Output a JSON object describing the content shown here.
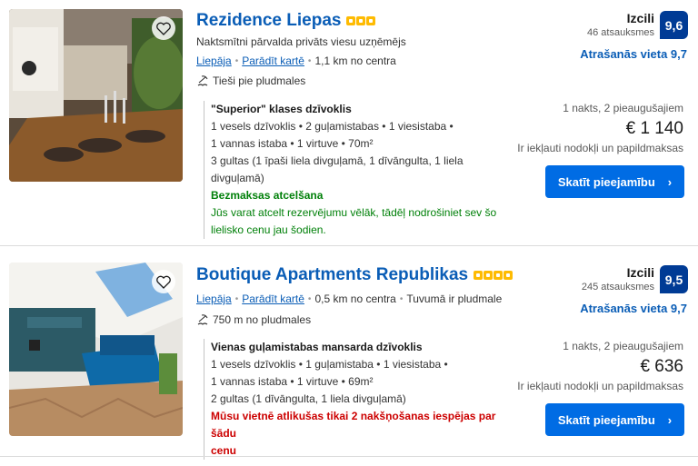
{
  "listings": [
    {
      "name": "Rezidence Liepas",
      "host": "Naktsmītni pārvalda privāts viesu uzņēmējs",
      "city": "Liepāja",
      "map_link": "Parādīt kartē",
      "distance": "1,1 km no centra",
      "extra_location": "",
      "beach": "Tieši pie pludmales",
      "room_type": "\"Superior\" klases dzīvoklis",
      "room_line1": "1 vesels dzīvoklis • 2 guļamistabas • 1 viesistaba •",
      "room_line2": "1 vannas istaba • 1 virtuve • 70m²",
      "beds": "3 gultas (1 īpaši liela divguļamā, 1 dīvāngulta, 1 liela divguļamā)",
      "cancel_title": "Bezmaksas atcelšana",
      "cancel_text1": "Jūs varat atcelt rezervējumu vēlāk, tādēļ nodrošiniet sev šo",
      "cancel_text2": "lielisko cenu jau šodien.",
      "rating_word": "Izcili",
      "reviews": "46 atsauksmes",
      "score": "9,6",
      "location_score": "Atrašanās vieta 9,7",
      "nights": "1 nakts, 2 pieaugušajiem",
      "price": "€ 1 140",
      "taxes": "Ir iekļauti nodokļi un papildmaksas",
      "button": "Skatīt pieejamību",
      "stars": 3
    },
    {
      "name": "Boutique Apartments Republikas",
      "city": "Liepāja",
      "map_link": "Parādīt kartē",
      "distance": "0,5 km no centra",
      "extra_location": "Tuvumā ir pludmale",
      "beach": "750 m no pludmales",
      "room_type": "Vienas guļamistabas mansarda dzīvoklis",
      "room_line1": "1 vesels dzīvoklis • 1 guļamistaba • 1 viesistaba •",
      "room_line2": "1 vannas istaba • 1 virtuve • 69m²",
      "beds": "2 gultas (1 dīvāngulta, 1 liela divguļamā)",
      "urgency1": "Mūsu vietnē atlikušas tikai 2 nakšņošanas iespējas par šādu",
      "urgency2": "cenu",
      "rating_word": "Izcili",
      "reviews": "245 atsauksmes",
      "score": "9,5",
      "location_score": "Atrašanās vieta 9,7",
      "nights": "1 nakts, 2 pieaugušajiem",
      "price": "€ 636",
      "taxes": "Ir iekļauti nodokļi un papildmaksas",
      "button": "Skatīt pieejamību",
      "stars": 4
    }
  ],
  "colors": {
    "link": "#0a5db6",
    "score_bg": "#003b95",
    "button_bg": "#006ce4",
    "green": "#008009",
    "red": "#cc0000",
    "star": "#febb02"
  }
}
